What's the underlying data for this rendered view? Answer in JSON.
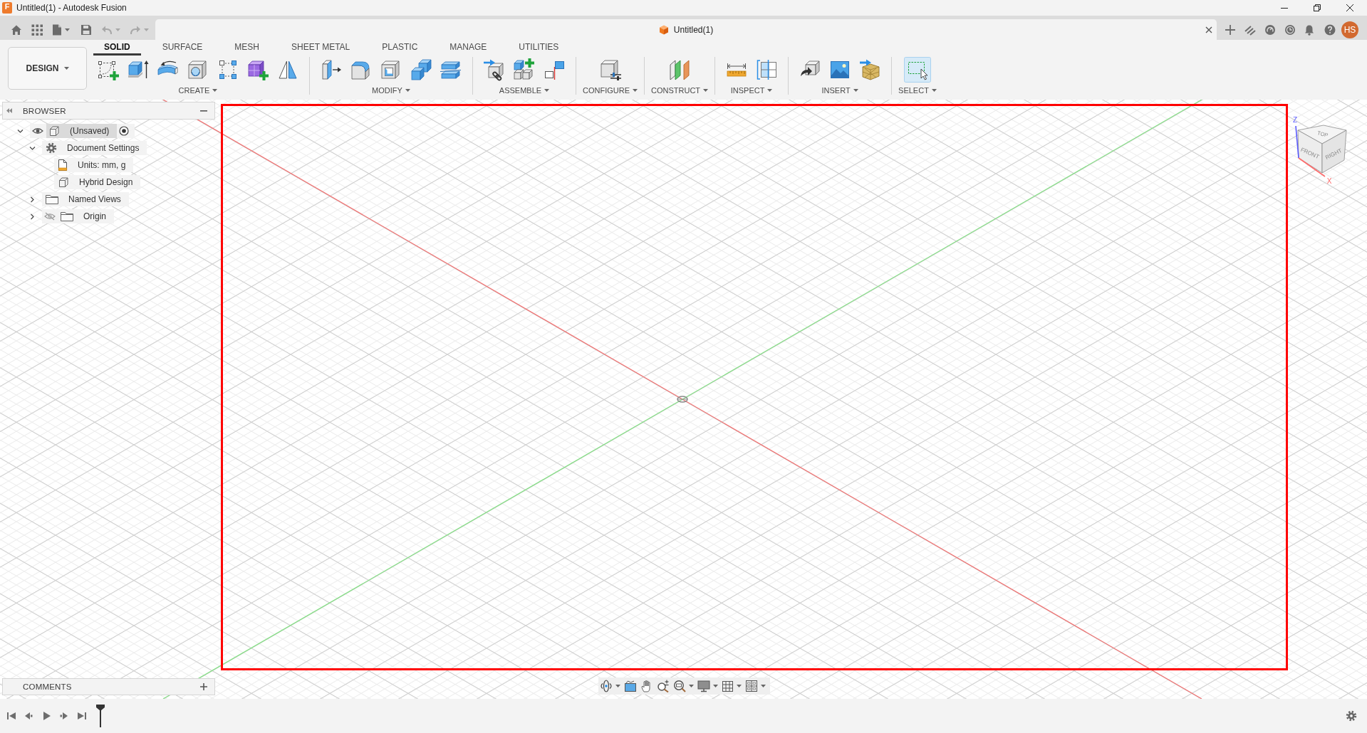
{
  "window": {
    "icon_text": "F",
    "title": "Untitled(1) - Autodesk Fusion"
  },
  "quick_access": {
    "undo": {
      "disabled": true
    },
    "redo": {
      "disabled": true
    }
  },
  "document_tab": {
    "title": "Untitled(1)"
  },
  "user": {
    "initials": "HS"
  },
  "workspace": {
    "label": "DESIGN"
  },
  "toolbar_tabs": [
    {
      "label": "SOLID",
      "selected": true
    },
    {
      "label": "SURFACE",
      "selected": false
    },
    {
      "label": "MESH",
      "selected": false
    },
    {
      "label": "SHEET METAL",
      "selected": false
    },
    {
      "label": "PLASTIC",
      "selected": false
    },
    {
      "label": "MANAGE",
      "selected": false
    },
    {
      "label": "UTILITIES",
      "selected": false
    }
  ],
  "toolbar_groups": [
    {
      "label": "CREATE"
    },
    {
      "label": "MODIFY"
    },
    {
      "label": "ASSEMBLE"
    },
    {
      "label": "CONFIGURE"
    },
    {
      "label": "CONSTRUCT"
    },
    {
      "label": "INSPECT"
    },
    {
      "label": "INSERT"
    },
    {
      "label": "SELECT"
    }
  ],
  "browser": {
    "title": "BROWSER",
    "tree": [
      {
        "kind": "component",
        "label": "(Unsaved)",
        "expanded": true,
        "visible": true,
        "active": true,
        "children": [
          {
            "kind": "settings",
            "label": "Document Settings",
            "expanded": true,
            "children": [
              {
                "kind": "units",
                "label": "Units: mm, g"
              },
              {
                "kind": "design",
                "label": "Hybrid Design"
              }
            ]
          },
          {
            "kind": "folder",
            "label": "Named Views",
            "expanded": false
          },
          {
            "kind": "folder",
            "label": "Origin",
            "expanded": false,
            "visible": false
          }
        ]
      }
    ]
  },
  "view_cube": {
    "faces": [
      "TOP",
      "FRONT",
      "RIGHT"
    ],
    "axes": [
      "Z",
      "X"
    ]
  },
  "comments": {
    "title": "COMMENTS"
  }
}
